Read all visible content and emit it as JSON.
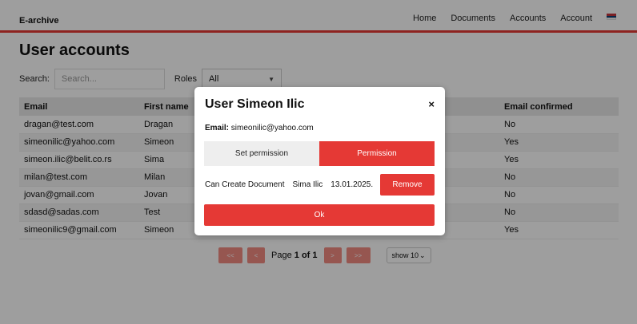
{
  "navbar": {
    "brand": "E-archive",
    "links": [
      "Home",
      "Documents",
      "Accounts",
      "Account"
    ],
    "flag_colors": [
      "#c6363c",
      "#0c4076",
      "#ffffff"
    ]
  },
  "page": {
    "title": "User accounts",
    "search_label": "Search:",
    "search_placeholder": "Search...",
    "roles_label": "Roles",
    "roles_value": "All"
  },
  "table": {
    "headers": [
      "Email",
      "First name",
      "Email confirmed"
    ],
    "rows": [
      {
        "email": "dragan@test.com",
        "first_name": "Dragan",
        "confirmed": "No"
      },
      {
        "email": "simeonilic@yahoo.com",
        "first_name": "Simeon",
        "confirmed": "Yes"
      },
      {
        "email": "simeon.ilic@belit.co.rs",
        "first_name": "Sima",
        "confirmed": "Yes"
      },
      {
        "email": "milan@test.com",
        "first_name": "Milan",
        "confirmed": "No"
      },
      {
        "email": "jovan@gmail.com",
        "first_name": "Jovan",
        "confirmed": "No"
      },
      {
        "email": "sdasd@sadas.com",
        "first_name": "Test",
        "confirmed": "No"
      },
      {
        "email": "simeonilic9@gmail.com",
        "first_name": "Simeon",
        "confirmed": "Yes"
      }
    ]
  },
  "pagination": {
    "first": "<<",
    "prev": "<",
    "page_prefix": "Page",
    "page_current": "1 of 1",
    "next": ">",
    "last": ">>",
    "show": "show 10"
  },
  "modal": {
    "title": "User Simeon Ilic",
    "close": "×",
    "email_label": "Email:",
    "email_value": "simeonilic@yahoo.com",
    "tab_set_permission": "Set permission",
    "tab_permission": "Permission",
    "permission": {
      "name": "Can Create Document",
      "by": "Sima Ilic",
      "date": "13.01.2025."
    },
    "remove": "Remove",
    "ok": "Ok"
  },
  "colors": {
    "accent": "#e53935",
    "overlay": "rgba(0,0,0,0.38)"
  }
}
